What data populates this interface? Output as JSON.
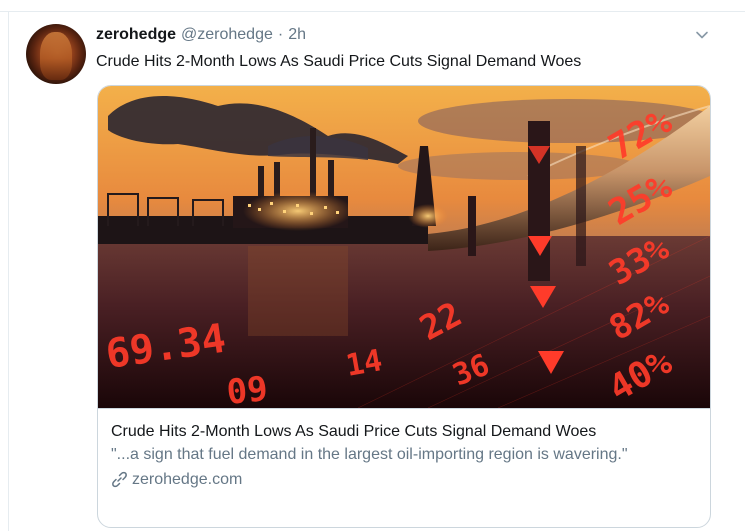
{
  "tweet": {
    "display_name": "zerohedge",
    "handle": "@zerohedge",
    "separator": "·",
    "time": "2h",
    "text": "Crude Hits 2-Month Lows As Saudi Price Cuts Signal Demand Woes",
    "more_icon": "chevron-down-icon"
  },
  "card": {
    "title": "Crude Hits 2-Month Lows As Saudi Price Cuts Signal Demand Woes",
    "description": "\"...a sign that fuel demand in the largest oil-importing region is wavering.\"",
    "domain": "zerohedge.com",
    "link_icon": "link-icon",
    "image_numbers": [
      "69.34",
      "09",
      "22",
      "36",
      "72%",
      "25%",
      "33%",
      "82%",
      "40%",
      "14"
    ]
  },
  "colors": {
    "primary_text": "#14171a",
    "secondary_text": "#657786",
    "border": "#ccd6dd",
    "ticker_red": "#ff3b2a"
  }
}
